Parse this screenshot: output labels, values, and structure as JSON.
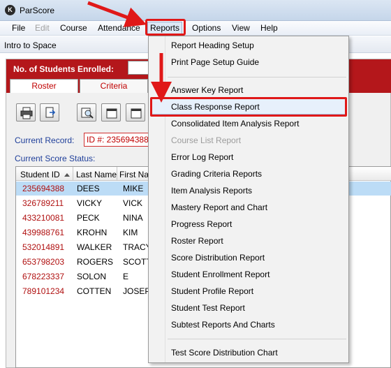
{
  "window": {
    "title": "ParScore",
    "app_icon_letter": "K"
  },
  "menubar": {
    "items": [
      {
        "label": "File",
        "state": "normal"
      },
      {
        "label": "Edit",
        "state": "disabled"
      },
      {
        "label": "Course",
        "state": "normal"
      },
      {
        "label": "Attendance",
        "state": "normal"
      },
      {
        "label": "Reports",
        "state": "active"
      },
      {
        "label": "Options",
        "state": "normal"
      },
      {
        "label": "View",
        "state": "normal"
      },
      {
        "label": "Help",
        "state": "normal"
      }
    ]
  },
  "document": {
    "title": "Intro to Space"
  },
  "enrollment": {
    "label": "No. of Students Enrolled:"
  },
  "tabs": [
    {
      "label": "Roster",
      "selected": true
    },
    {
      "label": "Criteria",
      "selected": false
    }
  ],
  "toolbar": {
    "buttons": [
      "print-icon",
      "export-icon",
      "search-icon",
      "calendar-icon",
      "calendar-icon"
    ]
  },
  "record": {
    "label": "Current Record:",
    "value": "ID #: 235694388"
  },
  "score_status": {
    "label": "Current Score Status:"
  },
  "grid": {
    "columns": [
      "Student ID",
      "Last Name",
      "First Na"
    ],
    "rows": [
      {
        "id": "235694388",
        "last": "DEES",
        "first": "MIKE",
        "selected": true
      },
      {
        "id": "326789211",
        "last": "VICKY",
        "first": "VICK",
        "selected": false
      },
      {
        "id": "433210081",
        "last": "PECK",
        "first": "NINA",
        "selected": false
      },
      {
        "id": "439988761",
        "last": "KROHN",
        "first": "KIM",
        "selected": false
      },
      {
        "id": "532014891",
        "last": "WALKER",
        "first": "TRACY",
        "selected": false
      },
      {
        "id": "653798203",
        "last": "ROGERS",
        "first": "SCOTT",
        "selected": false
      },
      {
        "id": "678223337",
        "last": "SOLON",
        "first": "E",
        "selected": false
      },
      {
        "id": "789101234",
        "last": "COTTEN",
        "first": "JOSEPH",
        "selected": false
      }
    ]
  },
  "reports_menu": {
    "items": [
      {
        "label": "Report Heading Setup",
        "state": "normal"
      },
      {
        "label": "Print Page Setup Guide",
        "state": "normal"
      },
      {
        "label": "Answer Key Report",
        "state": "normal"
      },
      {
        "label": "Class Response Report",
        "state": "highlighted"
      },
      {
        "label": "Consolidated Item Analysis Report",
        "state": "normal"
      },
      {
        "label": "Course List Report",
        "state": "disabled"
      },
      {
        "label": "Error Log Report",
        "state": "normal"
      },
      {
        "label": "Grading Criteria Reports",
        "state": "normal"
      },
      {
        "label": "Item Analysis Reports",
        "state": "normal"
      },
      {
        "label": "Mastery Report and Chart",
        "state": "normal"
      },
      {
        "label": "Progress Report",
        "state": "normal"
      },
      {
        "label": "Roster Report",
        "state": "normal"
      },
      {
        "label": "Score Distribution Report",
        "state": "normal"
      },
      {
        "label": "Student Enrollment Report",
        "state": "normal"
      },
      {
        "label": "Student Profile Report",
        "state": "normal"
      },
      {
        "label": "Student Test Report",
        "state": "normal"
      },
      {
        "label": "Subtest Reports And Charts",
        "state": "normal"
      },
      {
        "label": "Test Score Distribution Chart",
        "state": "normal"
      }
    ]
  },
  "colors": {
    "accent_red": "#b4171b",
    "annotation_red": "#e01818",
    "link_blue": "#1f3f9a",
    "selected_row": "#bcdcf6"
  }
}
